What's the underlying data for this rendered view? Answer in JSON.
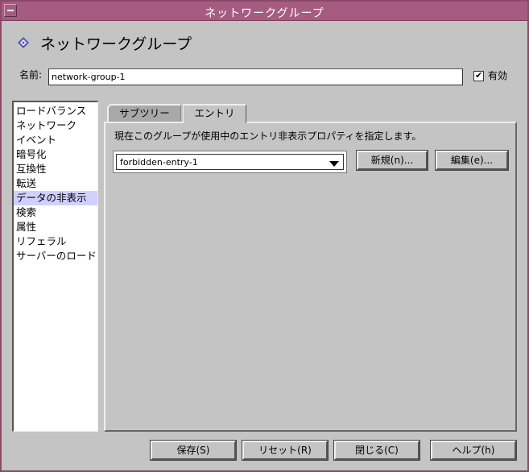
{
  "window": {
    "title": "ネットワークグループ"
  },
  "header": {
    "title": "ネットワークグループ"
  },
  "name_field": {
    "label": "名前:",
    "value": "network-group-1"
  },
  "enabled": {
    "label": "有効",
    "checked": true
  },
  "sidebar": {
    "items": [
      {
        "label": "ロードバランス"
      },
      {
        "label": "ネットワーク"
      },
      {
        "label": "イベント"
      },
      {
        "label": "暗号化"
      },
      {
        "label": "互換性"
      },
      {
        "label": "転送"
      },
      {
        "label": "データの非表示",
        "selected": true
      },
      {
        "label": "検索"
      },
      {
        "label": "属性"
      },
      {
        "label": "リフェラル"
      },
      {
        "label": "サーバーのロード"
      }
    ]
  },
  "tabs": [
    {
      "label": "サブツリー",
      "active": false
    },
    {
      "label": "エントリ",
      "active": true
    }
  ],
  "panel": {
    "description": "現在このグループが使用中のエントリ非表示プロパティを指定します。",
    "dropdown_value": "forbidden-entry-1",
    "new_label": "新規(n)...",
    "edit_label": "編集(e)..."
  },
  "footer": {
    "save_label": "保存(S)",
    "reset_label": "リセット(R)",
    "close_label": "閉じる(C)",
    "help_label": "ヘルプ(h)"
  },
  "icons": {
    "header": "diamond-icon",
    "window_menu": "window-menu-icon"
  },
  "colors": {
    "titlebar": "#a65c80",
    "selection": "#d0d0ff",
    "background": "#c4c4c4"
  }
}
